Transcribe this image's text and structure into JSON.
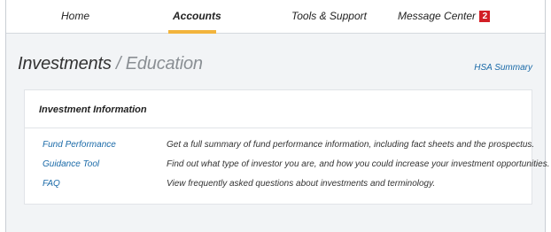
{
  "nav": {
    "items": [
      {
        "label": "Home"
      },
      {
        "label": "Accounts"
      },
      {
        "label": "Tools & Support"
      },
      {
        "label": "Message Center",
        "badge": "2"
      }
    ],
    "active": "Accounts"
  },
  "header": {
    "title": "Investments",
    "separator": "/",
    "subtitle": "Education",
    "hsa_link": "HSA Summary"
  },
  "card": {
    "title": "Investment Information",
    "rows": [
      {
        "link": "Fund Performance",
        "description": "Get a full summary of fund performance information, including fact sheets and the prospectus."
      },
      {
        "link": "Guidance Tool",
        "description": "Find out what type of investor you are, and how you could increase your investment opportunities."
      },
      {
        "link": "FAQ",
        "description": "View frequently asked questions about investments and terminology."
      }
    ]
  },
  "colors": {
    "accent": "#f2b43c",
    "link": "#1a6aa8",
    "badge": "#d21f26",
    "page_background": "#f2f4f6"
  }
}
